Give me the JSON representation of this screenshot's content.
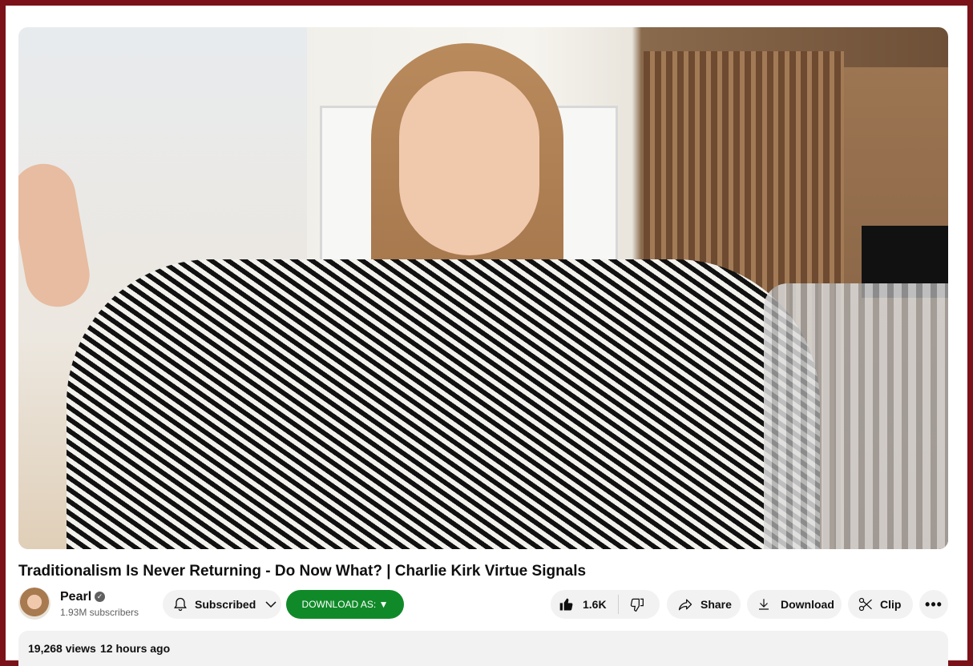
{
  "video": {
    "title": "Traditionalism Is Never Returning - Do Now What? | Charlie Kirk Virtue Signals"
  },
  "channel": {
    "name": "Pearl",
    "subscribers": "1.93M subscribers",
    "verified_icon": "check-circle"
  },
  "actions": {
    "subscribed_label": "Subscribed",
    "download_as_label": "DOWNLOAD AS: ▼",
    "like_count": "1.6K",
    "share_label": "Share",
    "download_label": "Download",
    "clip_label": "Clip",
    "more_label": "•••"
  },
  "description": {
    "views": "19,268 views",
    "time_ago": "12 hours ago"
  },
  "colors": {
    "frame_border": "#7b1219",
    "download_as_bg": "#108a29",
    "pill_bg": "#f2f2f2"
  }
}
